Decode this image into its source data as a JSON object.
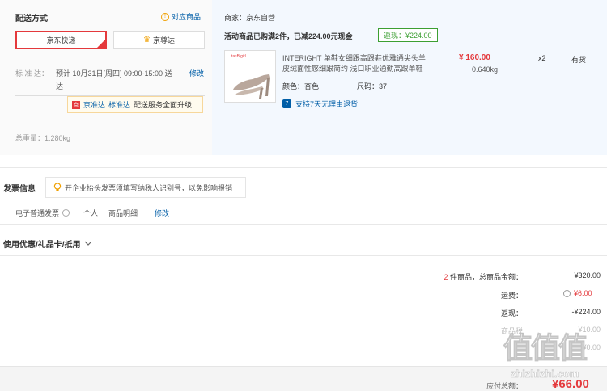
{
  "shipping": {
    "title": "配送方式",
    "corresponding_goods": "对应商品",
    "options": [
      "京东快递",
      "京尊达"
    ],
    "delivery_label": "标 准 达：",
    "delivery_time_line1": "预计 10月31日[周四] 09:00-15:00 送",
    "delivery_time_line2": "达",
    "modify": "修改",
    "upgrade_badge": "京准达",
    "upgrade_text1": "标准达",
    "upgrade_text2": "配送服务全面升级",
    "weight": "总重量：1.280kg"
  },
  "order": {
    "merchant": "商家：京东自营",
    "promo_text": "活动商品已购满2件，已减224.00元现金",
    "promo_badge": "返现：¥224.00",
    "product": {
      "image_brand": "tasBigirl",
      "title_line1": "INTERIGHT 单鞋女细跟高跟鞋优雅通尖头羊",
      "title_line2": "皮绒面性感细跟简约 浅口职业通勤高跟单鞋",
      "color_label": "颜色：杏色",
      "size_label": "尺码：37",
      "price": "¥ 160.00",
      "qty": "x2",
      "stock": "有货",
      "weight": "0.640kg",
      "return_policy": "支持7天无理由退货"
    }
  },
  "invoice": {
    "title": "发票信息",
    "tip": "开企业抬头发票须填写纳税人识别号，以免影响报销",
    "type": "电子普通发票",
    "person": "个人",
    "detail": "商品明细",
    "modify": "修改"
  },
  "coupon": {
    "title": "使用优惠/礼品卡/抵用"
  },
  "summary": {
    "count": "2",
    "count_text": "件商品，总商品金额：",
    "total": "¥320.00",
    "freight_label": "运费：",
    "freight": "¥6.00",
    "rebate_label": "返现：",
    "rebate": "-¥224.00",
    "faded1_label": "商品税",
    "faded1": "¥10.00",
    "faded2": "¥0.00",
    "pay_label": "应付总额：",
    "pay_total": "¥66.00"
  },
  "watermark": {
    "logo": "值值值",
    "site": "zhizhizhi.com"
  },
  "colors": {
    "accent": "#e4393c",
    "link": "#005ea7",
    "panel_blue": "#f3f8fe",
    "promo_green": "#3c9f32"
  }
}
